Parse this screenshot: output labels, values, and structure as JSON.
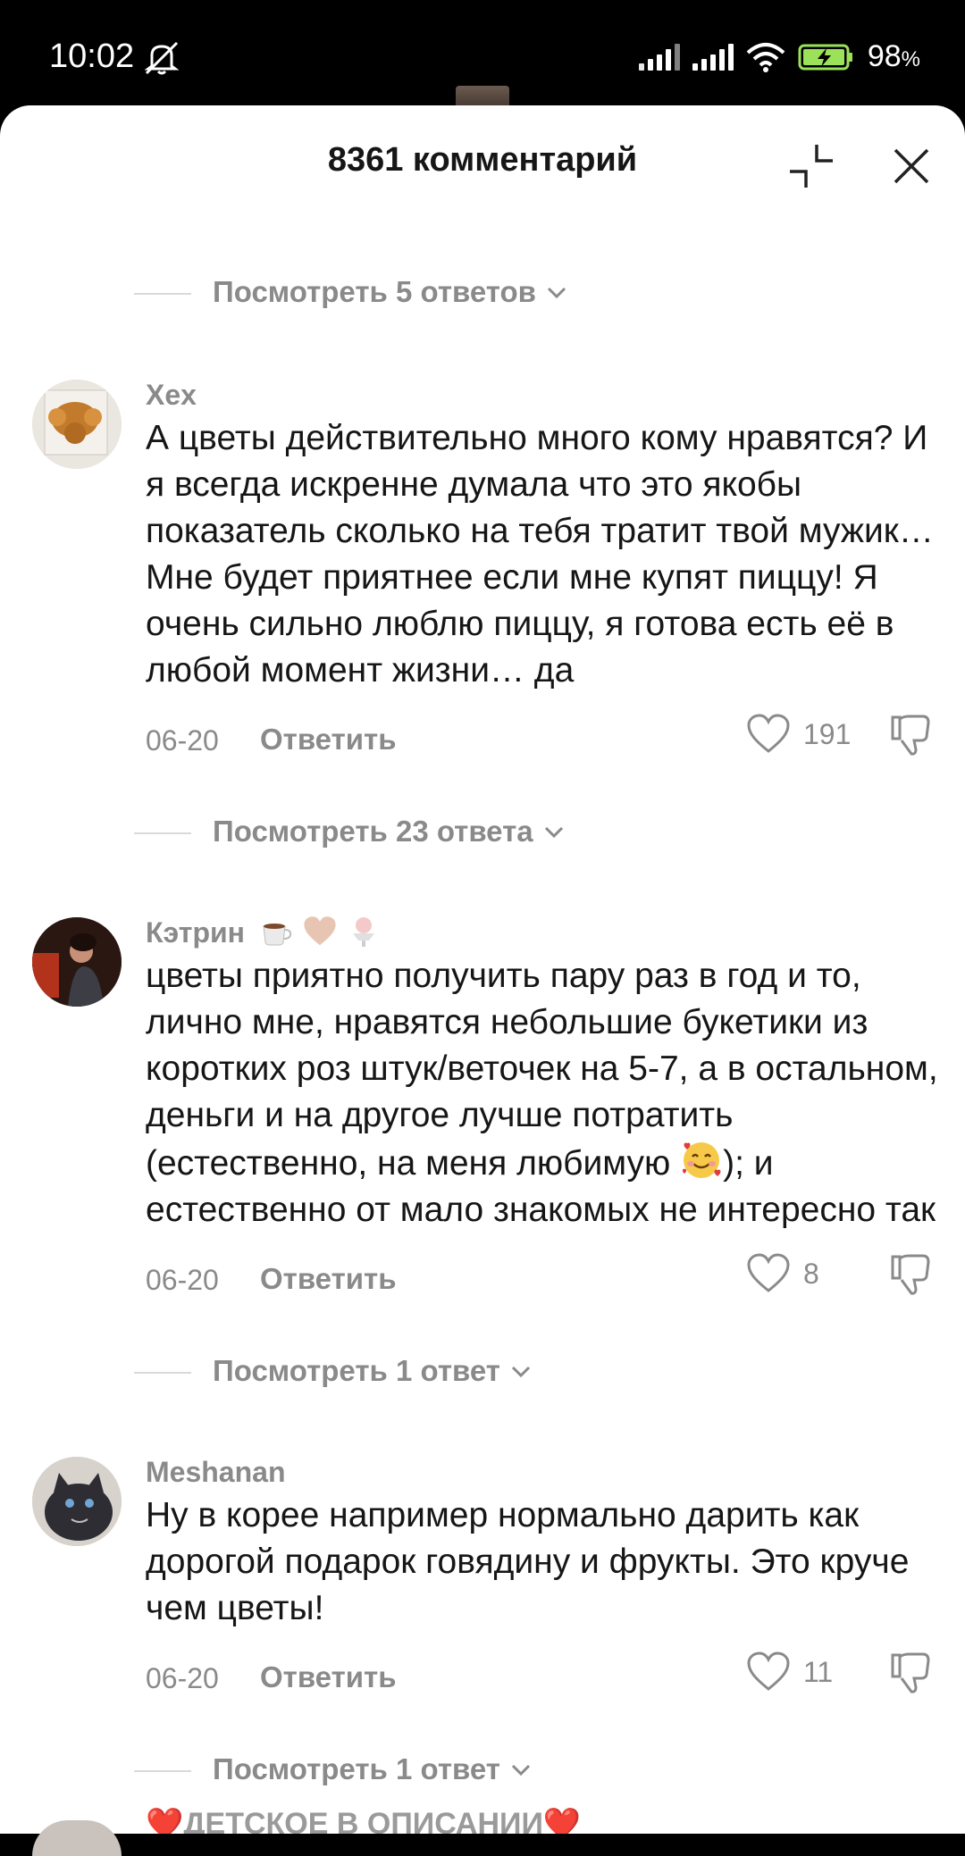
{
  "status_bar": {
    "time": "10:02",
    "battery_percent": "98",
    "battery_unit": "%",
    "icons": [
      "silent-icon",
      "signal-icon",
      "signal-icon",
      "wifi-icon",
      "battery-charging-icon"
    ]
  },
  "header": {
    "title": "8361 комментарий",
    "collapse_icon": "collapse-icon",
    "close_icon": "close-icon"
  },
  "top_replies": {
    "label": "Посмотреть 5 ответов"
  },
  "comments": [
    {
      "username": "Xex",
      "text": "А цветы действительно много кому нравятся? И я всегда искренне думала что это якобы показатель сколько на тебя тратит твой мужик… Мне будет приятнее если мне купят пиццу! Я очень сильно люблю пиццу, я готова есть её в любой момент жизни… да",
      "date": "06-20",
      "reply_label": "Ответить",
      "likes": "191",
      "replies_label": "Посмотреть 23 ответа"
    },
    {
      "username": "Кэтрин",
      "username_emoji": [
        "coffee-emoji",
        "heart-emoji",
        "ice-cream-emoji"
      ],
      "text_part1": "цветы приятно получить пару раз в год и то, лично мне, нравятся небольшие букетики из коротких роз штук/веточек на 5-7, а в остальном, деньги и на другое лучше потратить (естественно, на меня любимую ",
      "text_part2": "); и естественно от мало знакомых не интересно так",
      "inline_emoji": "smiling-face-with-hearts-emoji",
      "date": "06-20",
      "reply_label": "Ответить",
      "likes": "8",
      "replies_label": "Посмотреть 1 ответ"
    },
    {
      "username": "Meshanan",
      "text": "Ну в корее например нормально дарить как дорогой подарок говядину и фрукты. Это круче чем цветы!",
      "date": "06-20",
      "reply_label": "Ответить",
      "likes": "11",
      "replies_label": "Посмотреть 1 ответ"
    }
  ],
  "next_comment_peek": "❤️ДЕТСКОЕ В ОПИСАНИИ❤️"
}
